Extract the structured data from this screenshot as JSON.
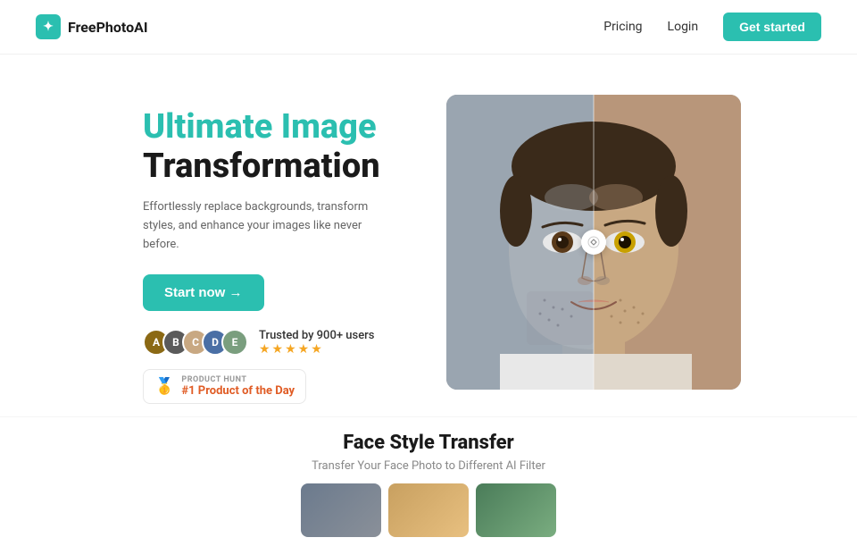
{
  "navbar": {
    "logo_text": "FreePhotoAI",
    "pricing_label": "Pricing",
    "login_label": "Login",
    "cta_label": "Get started"
  },
  "hero": {
    "title_accent": "Ultimate Image",
    "title_dark": "Transformation",
    "subtitle": "Effortlessly replace backgrounds, transform styles, and enhance your images like never before.",
    "start_btn_label": "Start now →",
    "trust_text": "Trusted by 900+ users",
    "product_hunt_label": "PRODUCT HUNT",
    "product_hunt_title": "#1 Product of the Day",
    "split_icon": "⇔",
    "avatars": [
      {
        "initials": "A",
        "class": "a1"
      },
      {
        "initials": "B",
        "class": "a2"
      },
      {
        "initials": "C",
        "class": "a3"
      },
      {
        "initials": "D",
        "class": "a4"
      },
      {
        "initials": "E",
        "class": "a5"
      }
    ],
    "stars": "★★★★★"
  },
  "bottom": {
    "title": "Face Style Transfer",
    "subtitle": "Transfer Your Face Photo to Different AI Filter"
  },
  "colors": {
    "accent": "#2bbfb0",
    "product_hunt_orange": "#e05c25"
  }
}
